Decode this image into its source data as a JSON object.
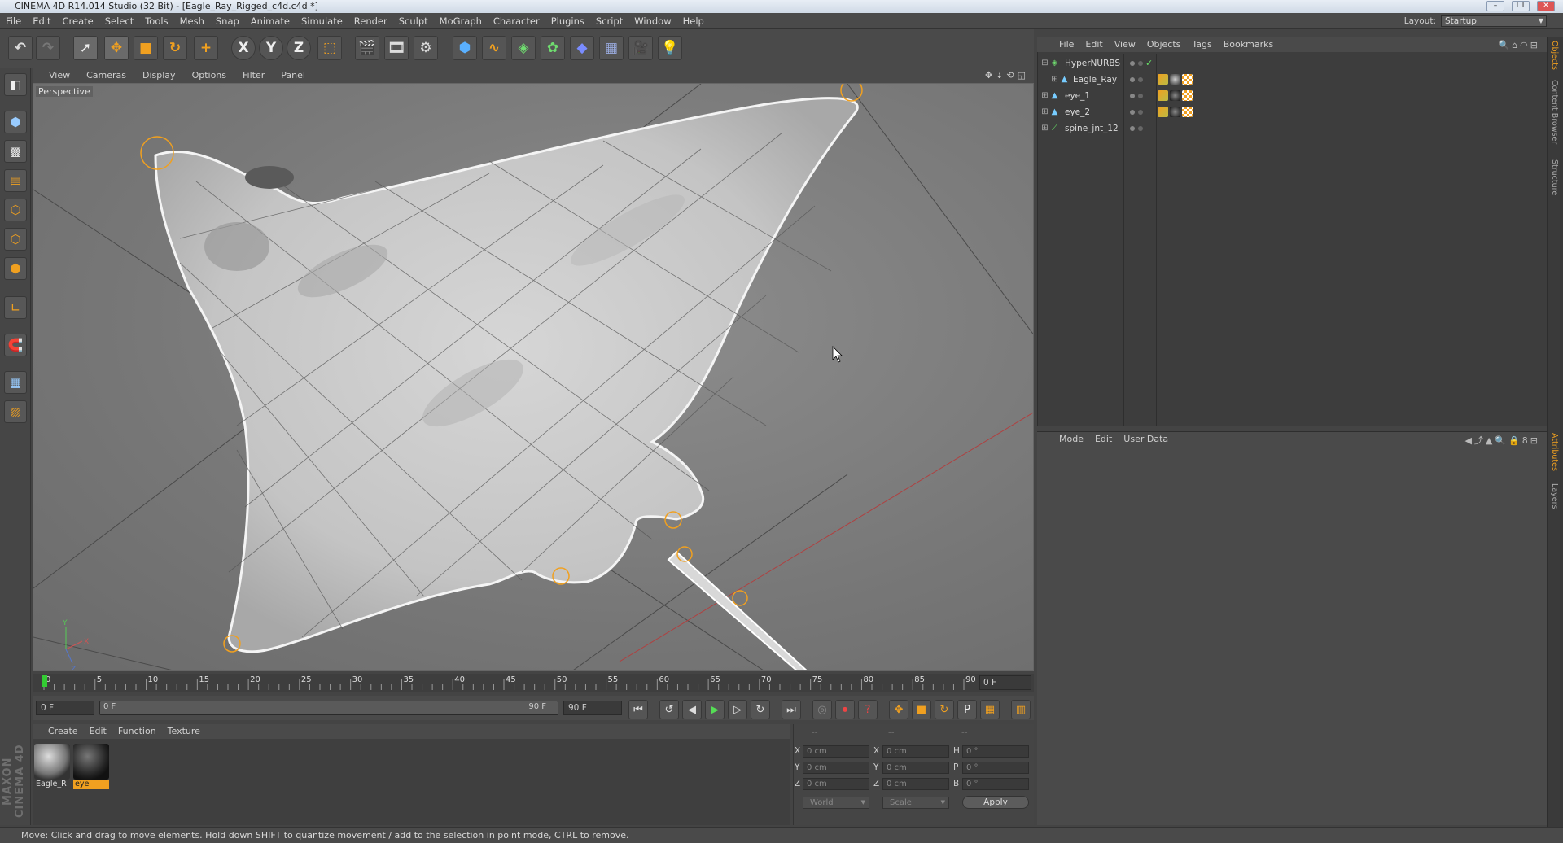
{
  "window": {
    "title": "CINEMA 4D R14.014 Studio (32 Bit) - [Eagle_Ray_Rigged_c4d.c4d *]"
  },
  "menubar": {
    "items": [
      "File",
      "Edit",
      "Create",
      "Select",
      "Tools",
      "Mesh",
      "Snap",
      "Animate",
      "Simulate",
      "Render",
      "Sculpt",
      "MoGraph",
      "Character",
      "Plugins",
      "Script",
      "Window",
      "Help"
    ],
    "layout_label": "Layout:",
    "layout_value": "Startup"
  },
  "viewport": {
    "menu": [
      "View",
      "Cameras",
      "Display",
      "Options",
      "Filter",
      "Panel"
    ],
    "camera_label": "Perspective"
  },
  "timeline": {
    "ticks": [
      "0",
      "5",
      "10",
      "15",
      "20",
      "25",
      "30",
      "35",
      "40",
      "45",
      "50",
      "55",
      "60",
      "65",
      "70",
      "75",
      "80",
      "85",
      "90"
    ],
    "current_frame": "0 F",
    "start_field": "0 F",
    "range_start": "0 F",
    "range_end": "90 F",
    "end_field": "90 F"
  },
  "materials": {
    "menu": [
      "Create",
      "Edit",
      "Function",
      "Texture"
    ],
    "items": [
      {
        "label": "Eagle_R",
        "selected": false
      },
      {
        "label": "eye",
        "selected": true
      }
    ]
  },
  "coordinates": {
    "headers": [
      "--",
      "--",
      "--"
    ],
    "rows": [
      {
        "a": "X",
        "a_val": "0 cm",
        "b": "X",
        "b_val": "0 cm",
        "c": "H",
        "c_val": "0 °"
      },
      {
        "a": "Y",
        "a_val": "0 cm",
        "b": "Y",
        "b_val": "0 cm",
        "c": "P",
        "c_val": "0 °"
      },
      {
        "a": "Z",
        "a_val": "0 cm",
        "b": "Z",
        "b_val": "0 cm",
        "c": "B",
        "c_val": "0 °"
      }
    ],
    "mode_select": "World",
    "scale_select": "Scale",
    "apply_label": "Apply"
  },
  "object_manager": {
    "menu": [
      "File",
      "Edit",
      "View",
      "Objects",
      "Tags",
      "Bookmarks"
    ],
    "objects": [
      {
        "name": "HyperNURBS",
        "icon": "hypernurbs-icon",
        "indent": 0,
        "has_tags": false,
        "check": "✓"
      },
      {
        "name": "Eagle_Ray",
        "icon": "polygon-object-icon",
        "indent": 1,
        "has_tags": true,
        "check": ""
      },
      {
        "name": "eye_1",
        "icon": "polygon-object-icon",
        "indent": 0,
        "has_tags": true,
        "check": ""
      },
      {
        "name": "eye_2",
        "icon": "polygon-object-icon",
        "indent": 0,
        "has_tags": true,
        "check": ""
      },
      {
        "name": "spine_jnt_12",
        "icon": "joint-icon",
        "indent": 0,
        "has_tags": false,
        "check": ""
      }
    ]
  },
  "attributes": {
    "menu": [
      "Mode",
      "Edit",
      "User Data"
    ]
  },
  "right_tabs": [
    "Objects",
    "Content Browser",
    "Structure",
    "Attributes",
    "Layers"
  ],
  "statusbar": {
    "text": "Move: Click and drag to move elements. Hold down SHIFT to quantize movement / add to the selection in point mode, CTRL to remove."
  },
  "colors": {
    "accent_orange": "#f0a020",
    "viewport_bg": "#7c7c7c",
    "object_name": "#dcdcdc"
  }
}
